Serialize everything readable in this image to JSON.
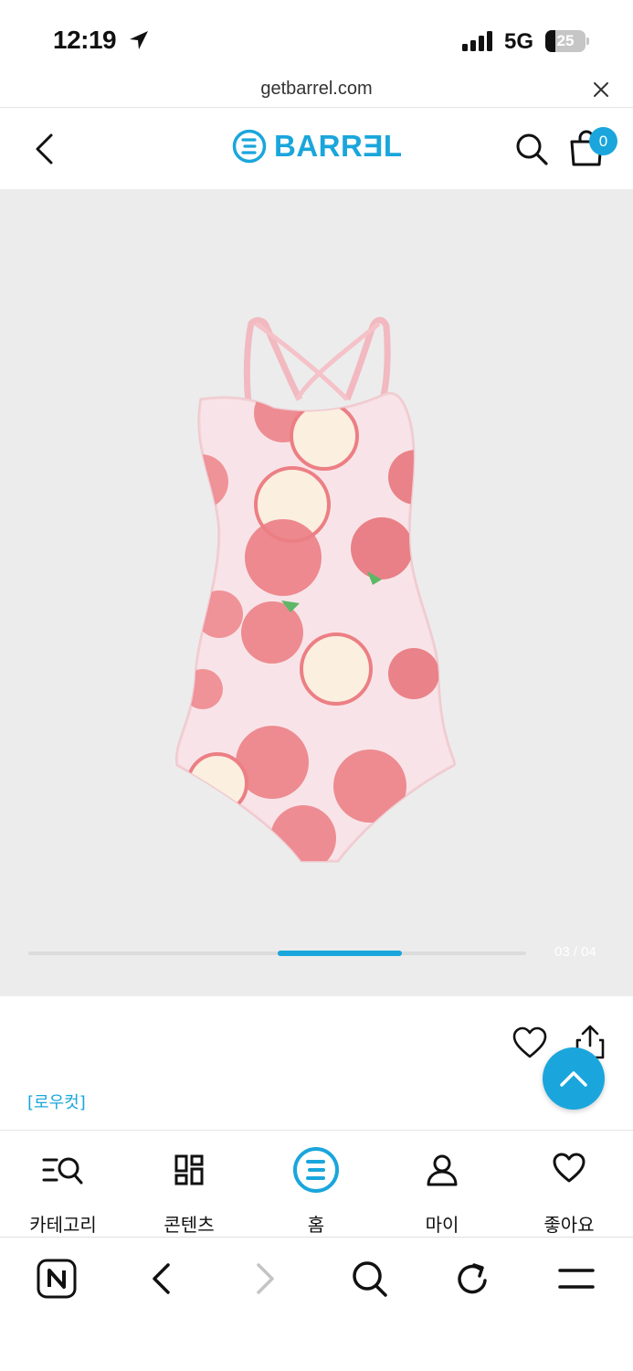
{
  "status": {
    "time": "12:19",
    "network": "5G",
    "battery": "25",
    "battery_level": 0.25
  },
  "url_bar": {
    "url": "getbarrel.com"
  },
  "header": {
    "logo_text": "BARRƎL",
    "cart_count": "0",
    "brand_color": "#1aa6dc"
  },
  "gallery": {
    "counter": "03 / 04",
    "current": 3,
    "total": 4
  },
  "product": {
    "brand_tag": "[로우컷]"
  },
  "tabs": [
    {
      "label": "카테고리",
      "icon": "category-search-icon"
    },
    {
      "label": "콘텐츠",
      "icon": "content-grid-icon"
    },
    {
      "label": "홈",
      "icon": "home-logo-icon"
    },
    {
      "label": "마이",
      "icon": "person-icon"
    },
    {
      "label": "좋아요",
      "icon": "heart-icon"
    }
  ],
  "browser_toolbar": {
    "items": [
      "naver-n-icon",
      "back-icon",
      "forward-icon",
      "search-icon",
      "refresh-icon",
      "menu-icon"
    ]
  }
}
